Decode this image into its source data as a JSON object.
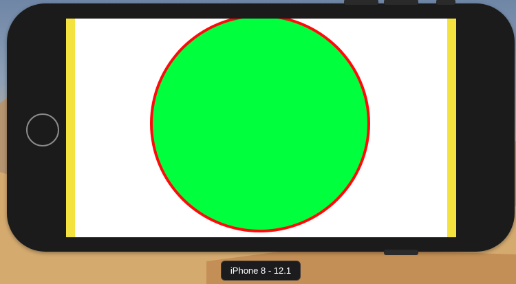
{
  "simulator": {
    "device_label": "iPhone 8 - 12.1"
  },
  "screen": {
    "background_color": "#ffffff",
    "side_bar_color": "#f4e23e",
    "circle": {
      "fill_color": "#00ff3c",
      "stroke_color": "#ff0a0a"
    }
  },
  "device_frame": {
    "body_color": "#1b1b1b",
    "home_button": "home-button-ring-icon"
  }
}
